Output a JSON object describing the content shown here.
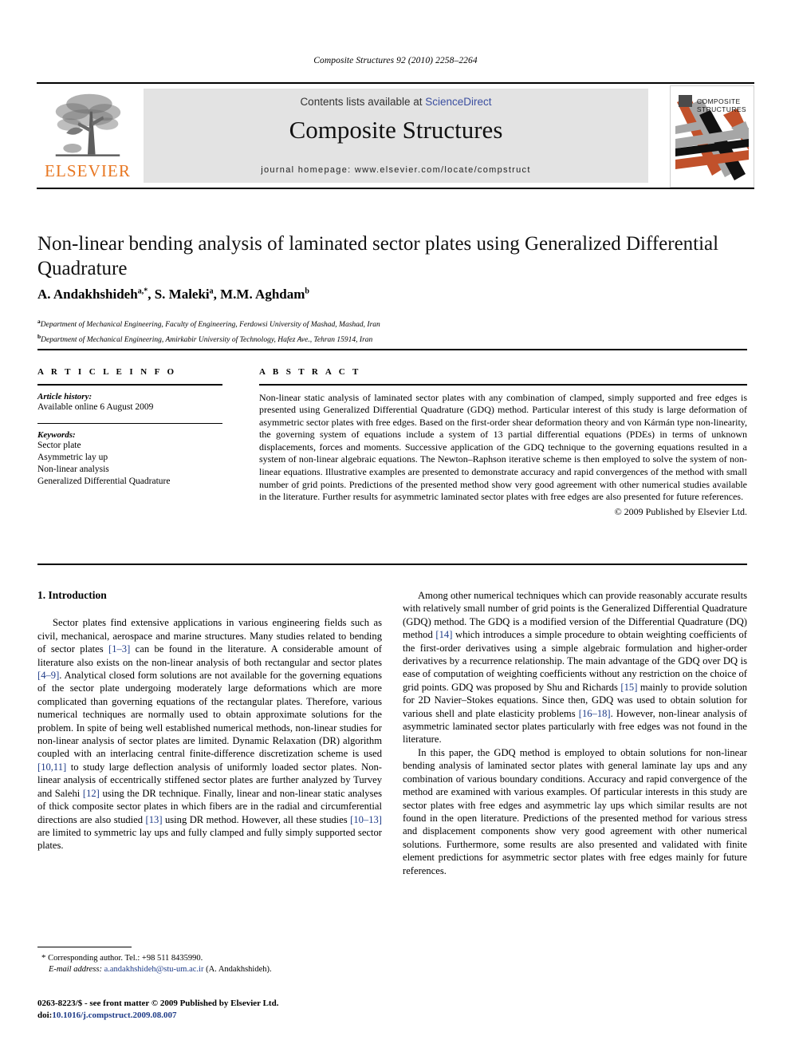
{
  "running_head": "Composite Structures 92 (2010) 2258–2264",
  "masthead": {
    "contents_prefix": "Contents lists available at ",
    "sciencedirect": "ScienceDirect",
    "journal_name": "Composite Structures",
    "homepage": "journal homepage: www.elsevier.com/locate/compstruct",
    "elsevier_wordmark": "ELSEVIER",
    "elsevier_orange": "#E87722",
    "cover_title_line1": "COMPOSITE",
    "cover_title_line2": "STRUCTURES",
    "link_color": "#3b4fa0"
  },
  "article": {
    "title": "Non-linear bending analysis of laminated sector plates using Generalized Differential Quadrature",
    "authors": "A. Andakhshideh",
    "authors_sup1": "a,*",
    "authors_mid": ", S. Maleki",
    "authors_sup2": "a",
    "authors_end": ", M.M. Aghdam",
    "authors_sup3": "b",
    "affiliation_a_sup": "a",
    "affiliation_a": "Department of Mechanical Engineering, Faculty of Engineering, Ferdowsi University of Mashad, Mashad, Iran",
    "affiliation_b_sup": "b",
    "affiliation_b": "Department of Mechanical Engineering, Amirkabir University of Technology, Hafez Ave., Tehran 15914, Iran"
  },
  "article_info": {
    "heading": "A R T I C L E    I N F O",
    "history_label": "Article history:",
    "history_value": "Available online 6 August 2009",
    "keywords_label": "Keywords:",
    "keywords": [
      "Sector plate",
      "Asymmetric lay up",
      "Non-linear analysis",
      "Generalized Differential Quadrature"
    ]
  },
  "abstract": {
    "heading": "A B S T R A C T",
    "text": "Non-linear static analysis of laminated sector plates with any combination of clamped, simply supported and free edges is presented using Generalized Differential Quadrature (GDQ) method. Particular interest of this study is large deformation of asymmetric sector plates with free edges. Based on the first-order shear deformation theory and von Kármán type non-linearity, the governing system of equations include a system of 13 partial differential equations (PDEs) in terms of unknown displacements, forces and moments. Successive application of the GDQ technique to the governing equations resulted in a system of non-linear algebraic equations. The Newton–Raphson iterative scheme is then employed to solve the system of non-linear equations. Illustrative examples are presented to demonstrate accuracy and rapid convergences of the method with small number of grid points. Predictions of the presented method show very good agreement with other numerical studies available in the literature. Further results for asymmetric laminated sector plates with free edges are also presented for future references.",
    "copyright": "© 2009 Published by Elsevier Ltd."
  },
  "body": {
    "section_heading": "1. Introduction",
    "left_paragraph_1_a": "Sector plates find extensive applications in various engineering fields such as civil, mechanical, aerospace and marine structures. Many studies related to bending of sector plates ",
    "left_ref_1": "[1–3]",
    "left_paragraph_1_b": " can be found in the literature. A considerable amount of literature also exists on the non-linear analysis of both rectangular and sector plates ",
    "left_ref_2": "[4–9]",
    "left_paragraph_1_c": ". Analytical closed form solutions are not available for the governing equations of the sector plate undergoing moderately large deformations which are more complicated than governing equations of the rectangular plates. Therefore, various numerical techniques are normally used to obtain approximate solutions for the problem. In spite of being well established numerical methods, non-linear studies for non-linear analysis of sector plates are limited. Dynamic Relaxation (DR) algorithm coupled with an interlacing central finite-difference discretization scheme is used ",
    "left_ref_3": "[10,11]",
    "left_paragraph_1_d": " to study large deflection analysis of uniformly loaded sector plates. Non-linear analysis of eccentrically stiffened sector plates are further analyzed by Turvey and Salehi ",
    "left_ref_4": "[12]",
    "left_paragraph_1_e": " using the DR technique. Finally, linear and non-linear static analyses of thick composite sector plates in which fibers are in the radial and circumferential directions are also studied ",
    "left_ref_5": "[13]",
    "left_paragraph_1_f": " using DR method. However, all these studies ",
    "left_ref_6": "[10–13]",
    "left_paragraph_1_g": " are limited to symmetric lay ups and fully clamped and fully simply supported sector plates.",
    "right_paragraph_1_a": "Among other numerical techniques which can provide reasonably accurate results with relatively small number of grid points is the Generalized Differential Quadrature (GDQ) method. The GDQ is a modified version of the Differential Quadrature (DQ) method ",
    "right_ref_1": "[14]",
    "right_paragraph_1_b": " which introduces a simple procedure to obtain weighting coefficients of the first-order derivatives using a simple algebraic formulation and higher-order derivatives by a recurrence relationship. The main advantage of the GDQ over DQ is ease of computation of weighting coefficients without any restriction on the choice of grid points. GDQ was proposed by Shu and Richards ",
    "right_ref_2": "[15]",
    "right_paragraph_1_c": " mainly to provide solution for 2D Navier–Stokes equations. Since then, GDQ was used to obtain solution for various shell and plate elasticity problems ",
    "right_ref_3": "[16–18]",
    "right_paragraph_1_d": ". However, non-linear analysis of asymmetric laminated sector plates particularly with free edges was not found in the literature.",
    "right_paragraph_2": "In this paper, the GDQ method is employed to obtain solutions for non-linear bending analysis of laminated sector plates with general laminate lay ups and any combination of various boundary conditions. Accuracy and rapid convergence of the method are examined with various examples. Of particular interests in this study are sector plates with free edges and asymmetric lay ups which similar results are not found in the open literature. Predictions of the presented method for various stress and displacement components show very good agreement with other numerical solutions. Furthermore, some results are also presented and validated with finite element predictions for asymmetric sector plates with free edges mainly for future references."
  },
  "footnote": {
    "marker": "*",
    "corresponding": "Corresponding author. Tel.: +98 511 8435990.",
    "email_label": "E-mail address:",
    "email": "a.andakhshideh@stu-um.ac.ir",
    "email_owner": "(A. Andakhshideh)."
  },
  "footer": {
    "issn_line": "0263-8223/$ - see front matter © 2009 Published by Elsevier Ltd.",
    "doi_label": "doi:",
    "doi_value": "10.1016/j.compstruct.2009.08.007"
  }
}
